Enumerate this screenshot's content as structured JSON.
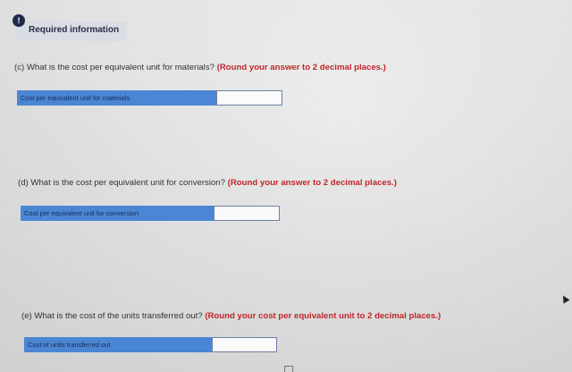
{
  "banner": {
    "icon": "exclamation-icon",
    "label": "Required information"
  },
  "questions": [
    {
      "text": "(c) What is the cost per equivalent unit for materials?",
      "hint": "(Round your answer to 2 decimal places.)",
      "field_label": "Cost per equivalent unit for materials",
      "value": ""
    },
    {
      "text": "(d) What is the cost per equivalent unit for conversion?",
      "hint": "(Round your answer to 2 decimal places.)",
      "field_label": "Cost per equivalent unit for conversion",
      "value": ""
    },
    {
      "text": "(e) What is the cost of the units transferred out?",
      "hint": "(Round your cost per equivalent unit to 2 decimal places.)",
      "field_label": "Cost of units transferred out",
      "value": ""
    }
  ],
  "colors": {
    "label_bg": "#4a86d3",
    "hint": "#c0262a",
    "banner_bg": "#d9dde4"
  }
}
